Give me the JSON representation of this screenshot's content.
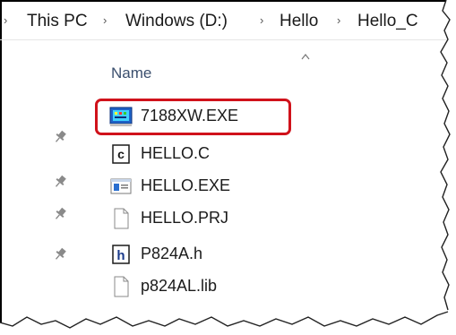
{
  "breadcrumb": {
    "items": [
      "This PC",
      "Windows (D:)",
      "Hello",
      "Hello_C"
    ],
    "separator": ">"
  },
  "list": {
    "column_header": "Name",
    "files": [
      {
        "name": "7188XW.EXE",
        "icon": "app-exe-colored-icon",
        "pinned": false,
        "highlighted": true
      },
      {
        "name": "HELLO.C",
        "icon": "c-source-file-icon",
        "pinned": true,
        "highlighted": false
      },
      {
        "name": "HELLO.EXE",
        "icon": "exe-window-icon",
        "pinned": true,
        "highlighted": false
      },
      {
        "name": "HELLO.PRJ",
        "icon": "blank-file-icon",
        "pinned": true,
        "highlighted": false
      },
      {
        "name": "P824A.h",
        "icon": "h-header-file-icon",
        "pinned": true,
        "highlighted": false
      },
      {
        "name": "p824AL.lib",
        "icon": "blank-file-icon",
        "pinned": false,
        "highlighted": false
      }
    ]
  },
  "colors": {
    "highlight_border": "#d0121b",
    "header_text": "#3b4f6e"
  }
}
